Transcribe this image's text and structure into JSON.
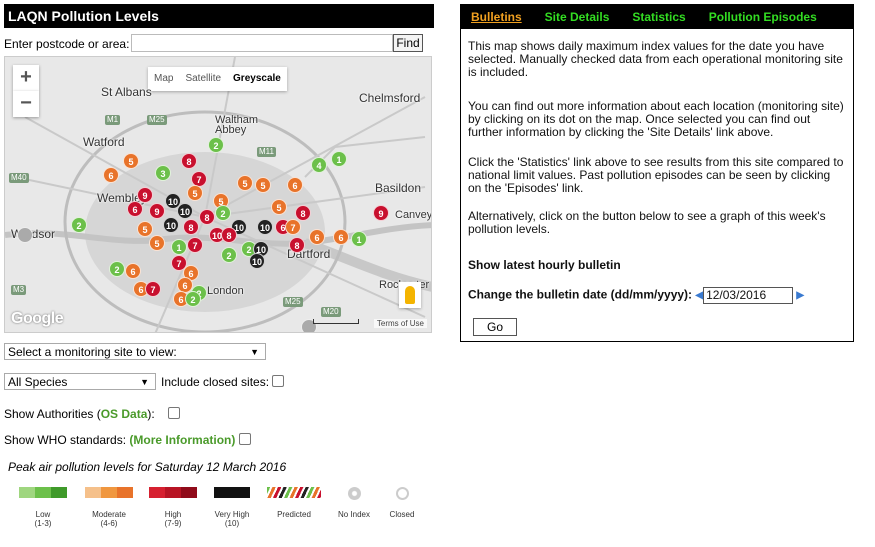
{
  "left": {
    "title": "LAQN Pollution Levels",
    "search": {
      "label": "Enter postcode or area:",
      "value": "",
      "placeholder": "",
      "button": "Find"
    },
    "map": {
      "zoom_in": "+",
      "zoom_out": "−",
      "map_types": [
        "Map",
        "Satellite",
        "Greyscale"
      ],
      "active_map_type": "Greyscale",
      "places": [
        "St Albans",
        "Chelmsford",
        "Watford",
        "Waltham Abbey",
        "Basildon",
        "Wembley",
        "Canvey",
        "Windsor",
        "Dartford",
        "Rochester",
        "London"
      ],
      "google": "Google",
      "terms": "Terms of Use"
    },
    "site_select": "Select a monitoring site to view:",
    "species_select": "All Species",
    "include_closed": "Include closed sites:",
    "show_authorities_prefix": "Show Authorities (",
    "os_data": "OS Data",
    "show_authorities_suffix": "):",
    "show_who": "Show WHO standards:",
    "more_info": "(More Information)",
    "peak_text": "Peak air pollution levels for Saturday 12 March 2016",
    "legend": [
      {
        "label": "Low",
        "range": "(1-3)"
      },
      {
        "label": "Moderate",
        "range": "(4-6)"
      },
      {
        "label": "High",
        "range": "(7-9)"
      },
      {
        "label": "Very High",
        "range": "(10)"
      },
      {
        "label": "Predicted",
        "range": ""
      },
      {
        "label": "No Index",
        "range": ""
      },
      {
        "label": "Closed",
        "range": ""
      }
    ],
    "colors": {
      "low": "#6cc04a",
      "moderate": "#e8732a",
      "high": "#c8102e",
      "very_high": "#222222"
    }
  },
  "right": {
    "tabs": [
      "Bulletins",
      "Site Details",
      "Statistics",
      "Pollution Episodes"
    ],
    "active_tab": "Bulletins",
    "p1": "This map shows daily maximum index values for the date you have selected. Manually checked data from each operational monitoring site is included.",
    "p2": "You can find out more information about each location (monitoring site) by clicking on its dot on the map. Once selected you can find out further information by clicking the 'Site Details' link above.",
    "p3": "Click the 'Statistics' link above to see results from this site compared to national limit values. Past pollution episodes can be seen by clicking on the 'Episodes' link.",
    "p4": "Alternatively, click on the button below to see a graph of this week's pollution levels.",
    "hourly_link": "Show latest hourly bulletin",
    "date_label": "Change the bulletin date (dd/mm/yyyy):",
    "date_value": "12/03/2016",
    "go": "Go"
  }
}
